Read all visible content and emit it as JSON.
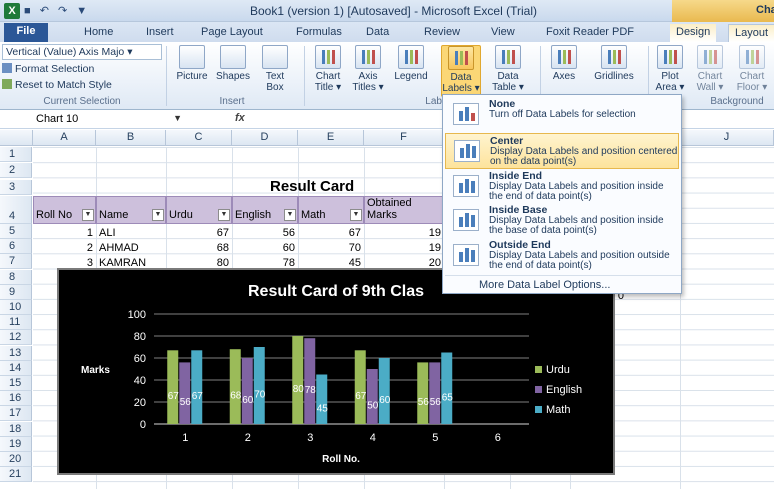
{
  "window": {
    "title": "Book1 (version 1) [Autosaved] - Microsoft Excel (Trial)",
    "context_tab_group": "Chart To"
  },
  "tabs": [
    {
      "label": "File"
    },
    {
      "label": "Home"
    },
    {
      "label": "Insert"
    },
    {
      "label": "Page Layout"
    },
    {
      "label": "Formulas"
    },
    {
      "label": "Data"
    },
    {
      "label": "Review"
    },
    {
      "label": "View"
    },
    {
      "label": "Foxit Reader PDF"
    },
    {
      "label": "Design"
    },
    {
      "label": "Layout"
    }
  ],
  "ribbon": {
    "current_selection": {
      "dropdown_value": "Vertical (Value) Axis Majo",
      "format_selection": "Format Selection",
      "reset_to_match": "Reset to Match Style",
      "group_label": "Current Selection"
    },
    "insert": {
      "picture": "Picture",
      "shapes": "Shapes",
      "text_box_1": "Text",
      "text_box_2": "Box",
      "group_label": "Insert"
    },
    "labels": {
      "chart_title_1": "Chart",
      "chart_title_2": "Title ▾",
      "axis_titles_1": "Axis",
      "axis_titles_2": "Titles ▾",
      "legend": "Legend",
      "data_labels_1": "Data",
      "data_labels_2": "Labels ▾",
      "data_table_1": "Data",
      "data_table_2": "Table ▾",
      "group_label": "Labels"
    },
    "axes": {
      "axes": "Axes",
      "gridlines": "Gridlines"
    },
    "background": {
      "plot_area_1": "Plot",
      "plot_area_2": "Area ▾",
      "chart_wall_1": "Chart",
      "chart_wall_2": "Wall ▾",
      "chart_floor_1": "Chart",
      "chart_floor_2": "Floor ▾",
      "group_label": "Background"
    }
  },
  "formula_bar": {
    "name_box": "Chart 10",
    "fx": "fx"
  },
  "columns": [
    "A",
    "B",
    "C",
    "D",
    "E",
    "F",
    "G",
    "H",
    "I",
    "J"
  ],
  "rows": [
    "1",
    "2",
    "3",
    "4",
    "5",
    "6",
    "7",
    "8",
    "9",
    "10",
    "11",
    "12",
    "13",
    "14",
    "15",
    "16",
    "17",
    "18",
    "19",
    "20",
    "21"
  ],
  "sheet": {
    "result_title": "Result Card",
    "headers": [
      "Roll No",
      "Name",
      "Urdu",
      "English",
      "Math",
      "Obtained",
      "Marks"
    ],
    "records": [
      {
        "roll": "1",
        "name": "ALI",
        "urdu": "67",
        "english": "56",
        "math": "67",
        "obtained": "19"
      },
      {
        "roll": "2",
        "name": "AHMAD",
        "urdu": "68",
        "english": "60",
        "math": "70",
        "obtained": "19"
      },
      {
        "roll": "3",
        "name": "KAMRAN",
        "urdu": "80",
        "english": "78",
        "math": "45",
        "obtained": "20"
      }
    ],
    "row9_partial": "0"
  },
  "data_labels_menu": {
    "items": [
      {
        "title": "None",
        "desc": "Turn off Data Labels for selection"
      },
      {
        "title": "Center",
        "desc": "Display Data Labels and position centered on the data point(s)"
      },
      {
        "title": "Inside End",
        "desc": "Display Data Labels and position inside the end of data point(s)"
      },
      {
        "title": "Inside Base",
        "desc": "Display Data Labels and position inside the base of data point(s)"
      },
      {
        "title": "Outside End",
        "desc": "Display Data Labels and position outside the end of data point(s)"
      }
    ],
    "more": "More Data Label Options..."
  },
  "colors": {
    "urdu": "#9bbb59",
    "english": "#8064a2",
    "math": "#4bacc6",
    "chart_bg": "#000000",
    "table_header": "#cdc0dc"
  },
  "chart_data": {
    "type": "bar",
    "title": "Result Card of 9th Clas",
    "xlabel": "Roll No.",
    "ylabel": "Marks",
    "categories": [
      "1",
      "2",
      "3",
      "4",
      "5",
      "6"
    ],
    "ylim": [
      0,
      100
    ],
    "yticks": [
      0,
      20,
      40,
      60,
      80,
      100
    ],
    "legend_position": "right",
    "grid": true,
    "series": [
      {
        "name": "Urdu",
        "values": [
          67,
          68,
          80,
          67,
          56,
          null
        ]
      },
      {
        "name": "English",
        "values": [
          56,
          60,
          78,
          50,
          56,
          null
        ]
      },
      {
        "name": "Math",
        "values": [
          67,
          70,
          45,
          60,
          65,
          null
        ]
      }
    ]
  }
}
